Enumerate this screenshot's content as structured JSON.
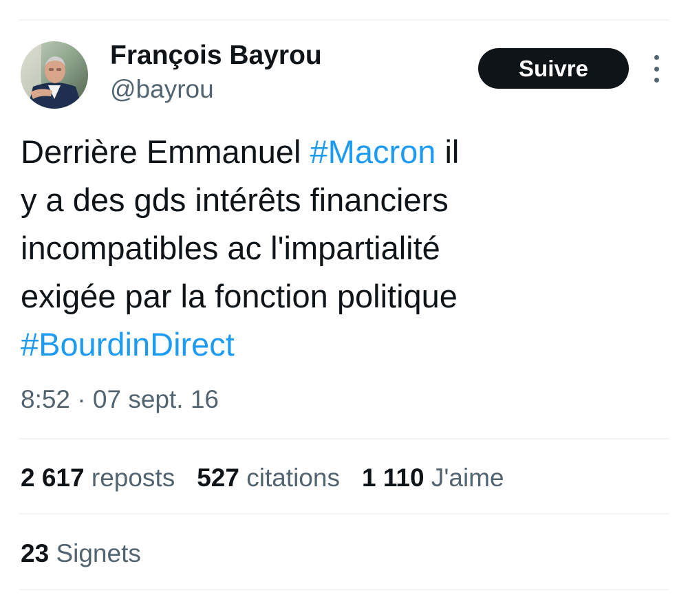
{
  "tweet": {
    "author": {
      "name": "François Bayrou",
      "handle": "@bayrou"
    },
    "follow_label": "Suivre",
    "text": {
      "line1_pre": "Derrière Emmanuel ",
      "line1_hashtag": "#Macron",
      "line1_post": " il",
      "line2": "y a des gds intérêts financiers",
      "line3": "incompatibles ac l'impartialité",
      "line4": "exigée par la fonction politique",
      "line5_hashtag": "#BourdinDirect"
    },
    "timestamp": "8:52 · 07 sept. 16",
    "stats": {
      "reposts_count": "2 617",
      "reposts_label": "reposts",
      "quotes_count": "527",
      "quotes_label": "citations",
      "likes_count": "1 110",
      "likes_label": "J'aime",
      "bookmarks_count": "23",
      "bookmarks_label": "Signets"
    }
  },
  "icons": {
    "avatar": "profile-photo",
    "more": "more-vertical-icon"
  },
  "colors": {
    "text": "#0f1419",
    "secondary": "#536471",
    "hashtag": "#1d9bf0",
    "button_bg": "#0f1419",
    "button_text": "#ffffff",
    "divider": "#eff3f4"
  }
}
